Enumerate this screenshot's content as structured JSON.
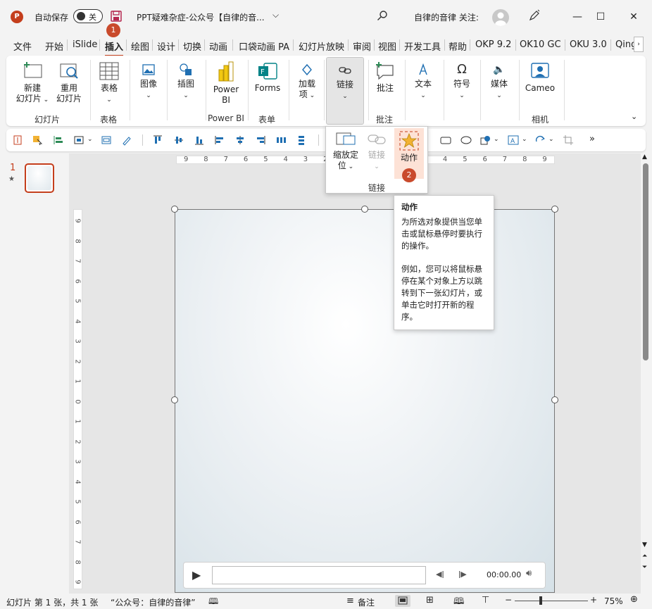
{
  "titlebar": {
    "autosave_label": "自动保存",
    "autosave_state": "关",
    "doc_title": "PPT疑难杂症-公众号【自律的音...",
    "account_text": "自律的音律 关注:",
    "badge_save": "1"
  },
  "tabs": [
    "文件",
    "开始",
    "iSlide",
    "插入",
    "绘图",
    "设计",
    "切换",
    "动画",
    "口袋动画 PA",
    "幻灯片放映",
    "审阅",
    "视图",
    "开发工具",
    "帮助",
    "OKP 9.2",
    "OK10 GC",
    "OKU 3.0",
    "Qing"
  ],
  "active_tab": "插入",
  "ribbon": {
    "new_slide": "新建\n幻灯片",
    "reuse_slide": "重用\n幻灯片",
    "group_slides": "幻灯片",
    "table": "表格",
    "group_table": "表格",
    "image": "图像",
    "illustration": "插图",
    "powerbi": "Power\nBI",
    "group_powerbi": "Power BI",
    "forms": "Forms",
    "group_forms": "表单",
    "addins": "加载\n项",
    "links": "链接",
    "comment": "批注",
    "group_comment": "批注",
    "text": "文本",
    "symbol": "符号",
    "media": "媒体",
    "cameo": "Cameo",
    "group_camera": "相机"
  },
  "dropdown": {
    "zoom": "缩放定\n位",
    "link": "链接",
    "action": "动作",
    "badge_action": "2",
    "group_label": "链接"
  },
  "tooltip": {
    "title": "动作",
    "body1": "为所选对象提供当您单击或鼠标悬停时要执行的操作。",
    "body2": "例如，您可以将鼠标悬停在某个对象上方以跳转到下一张幻灯片，或单击它时打开新的程序。"
  },
  "thumb": {
    "number": "1",
    "star": "★"
  },
  "ruler_h": [
    "9",
    "8",
    "7",
    "6",
    "5",
    "4",
    "3",
    "2",
    "1",
    "0",
    "1",
    "2",
    "3",
    "4",
    "5",
    "6",
    "7",
    "8",
    "9"
  ],
  "ruler_v": [
    "9",
    "8",
    "7",
    "6",
    "5",
    "4",
    "3",
    "2",
    "1",
    "0",
    "1",
    "2",
    "3",
    "4",
    "5",
    "6",
    "7",
    "8",
    "9"
  ],
  "media_bar": {
    "time": "00:00.00"
  },
  "statusbar": {
    "slide_info": "幻灯片 第 1 张，共 1 张",
    "theme": "“公众号：自律的音律”",
    "notes": "备注",
    "zoom": "75%"
  },
  "colors": {
    "accent": "#c43e1c",
    "badge": "#c94a2c",
    "highlight": "#fde2d6"
  }
}
